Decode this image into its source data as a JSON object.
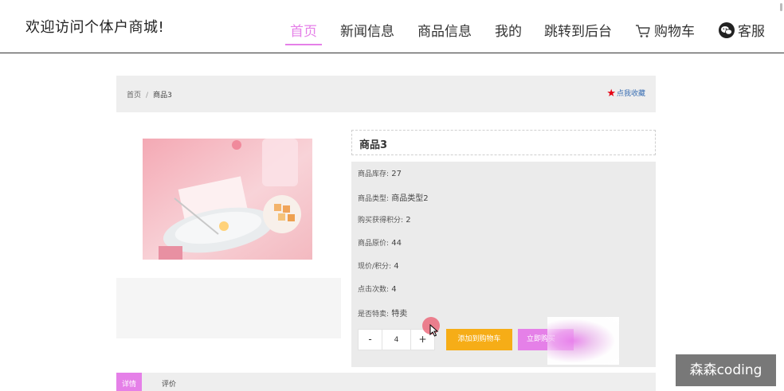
{
  "header": {
    "site_title": "欢迎访问个体户商城!",
    "nav": [
      {
        "label": "首页",
        "active": true
      },
      {
        "label": "新闻信息",
        "active": false
      },
      {
        "label": "商品信息",
        "active": false
      },
      {
        "label": "我的",
        "active": false
      },
      {
        "label": "跳转到后台",
        "active": false
      },
      {
        "label": "购物车",
        "icon": "cart-icon",
        "active": false
      },
      {
        "label": "客服",
        "icon": "wechat-icon",
        "active": false
      }
    ]
  },
  "breadcrumb": {
    "home": "首页",
    "separator": "/",
    "current": "商品3"
  },
  "favorite": {
    "icon": "star-icon",
    "label": "点我收藏"
  },
  "product": {
    "title": "商品3",
    "image": "food-photo",
    "info": [
      {
        "key": "商品库存:",
        "value": "27"
      },
      {
        "key": "商品类型:",
        "value": "商品类型2"
      },
      {
        "key": "购买获得积分:",
        "value": "2"
      },
      {
        "key": "商品原价:",
        "value": "44"
      },
      {
        "key": "现价/积分:",
        "value": "4"
      },
      {
        "key": "点击次数:",
        "value": "4"
      },
      {
        "key": "是否特卖:",
        "value": "特卖"
      }
    ]
  },
  "purchase": {
    "minus_label": "-",
    "quantity": "4",
    "plus_label": "+",
    "add_to_cart_label": "添加到购物车",
    "buy_now_label": "立即购买"
  },
  "tabs": [
    {
      "label": "详情",
      "active": true
    },
    {
      "label": "评价",
      "active": false
    }
  ],
  "watermark": "森森coding",
  "colors": {
    "accent": "#e580e8",
    "cart_button": "#f6ad17",
    "favorite_star": "#e60012",
    "panel_bg": "#ebebeb"
  }
}
